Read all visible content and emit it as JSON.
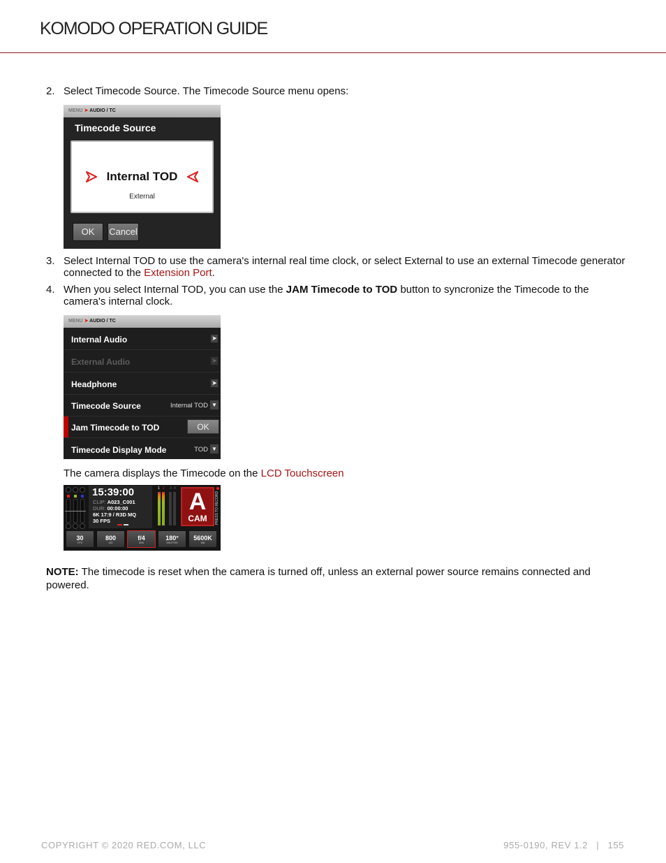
{
  "header": {
    "title": "KOMODO OPERATION GUIDE"
  },
  "steps": [
    {
      "num": "2.",
      "text": "Select Timecode Source. The Timecode Source menu opens:"
    },
    {
      "num": "3.",
      "text_before": "Select Internal TOD to use the camera's internal real time clock, or select External to use an external Timecode generator connected to the ",
      "link": "Extension Port",
      "text_after": "."
    },
    {
      "num": "4.",
      "text_before": "When you select Internal TOD, you can use the ",
      "bold": "JAM Timecode to TOD",
      "text_after": " button to syncronize the Timecode to the camera's internal clock."
    }
  ],
  "screen_timecode_source": {
    "breadcrumb": {
      "menu": "MENU",
      "arrow": "➤",
      "path": "AUDIO / TC"
    },
    "title": "Timecode Source",
    "selected_option": "Internal TOD",
    "other_option": "External",
    "ok_label": "OK",
    "cancel_label": "Cancel",
    "accent_color": "#e01b1b"
  },
  "screen_audio_tc_menu": {
    "breadcrumb": {
      "menu": "MENU",
      "arrow": "➤",
      "path": "AUDIO / TC"
    },
    "rows": [
      {
        "label": "Internal Audio",
        "control": "chevron-right",
        "disabled": false
      },
      {
        "label": "External Audio",
        "control": "chevron-right",
        "disabled": true
      },
      {
        "label": "Headphone",
        "control": "chevron-right",
        "disabled": false
      },
      {
        "label": "Timecode Source",
        "control": "dropdown",
        "value": "Internal TOD"
      },
      {
        "label": "Jam Timecode to TOD",
        "control": "button",
        "value": "OK",
        "highlighted": true
      },
      {
        "label": "Timecode Display Mode",
        "control": "dropdown",
        "value": "TOD"
      }
    ],
    "chevron_glyph": "➤",
    "dropdown_glyph": "▼"
  },
  "caption": {
    "text": "The camera displays the Timecode on the ",
    "link": "LCD Touchscreen"
  },
  "screen_lcd": {
    "timecode": "15:39:00",
    "clip_key": "CLIP:",
    "clip_value": "A023_C001",
    "dur_key": "DUR:",
    "dur_value": "00:00:00",
    "format": "6K 17:9 / R3D MQ",
    "fps": "30 FPS",
    "channels": [
      "1",
      "2",
      "3",
      "4"
    ],
    "cam_letter": "A",
    "cam_label": "CAM",
    "record_label": "PRESS TO RECORD",
    "rgb_labels": [
      "R",
      "G",
      "B"
    ],
    "tiles": [
      {
        "value": "30",
        "unit": "FPS",
        "active": false
      },
      {
        "value": "800",
        "unit": "ISO",
        "active": false
      },
      {
        "value": "f/4",
        "unit": "IRIS",
        "active": true
      },
      {
        "value": "180°",
        "unit": "SHUTTER",
        "active": false
      },
      {
        "value": "5600K",
        "unit": "WB",
        "active": false
      }
    ]
  },
  "note": {
    "label": "NOTE:",
    "text": " The timecode is reset when the camera is turned off, unless an external power source remains connected and powered."
  },
  "footer": {
    "copyright": "COPYRIGHT © 2020 RED.COM, LLC",
    "doc_rev": "955-0190, REV 1.2",
    "separator": "|",
    "page": "155"
  },
  "colors": {
    "link": "#a31515",
    "rule": "#8b1a1a",
    "footer": "#aaaaaa"
  }
}
